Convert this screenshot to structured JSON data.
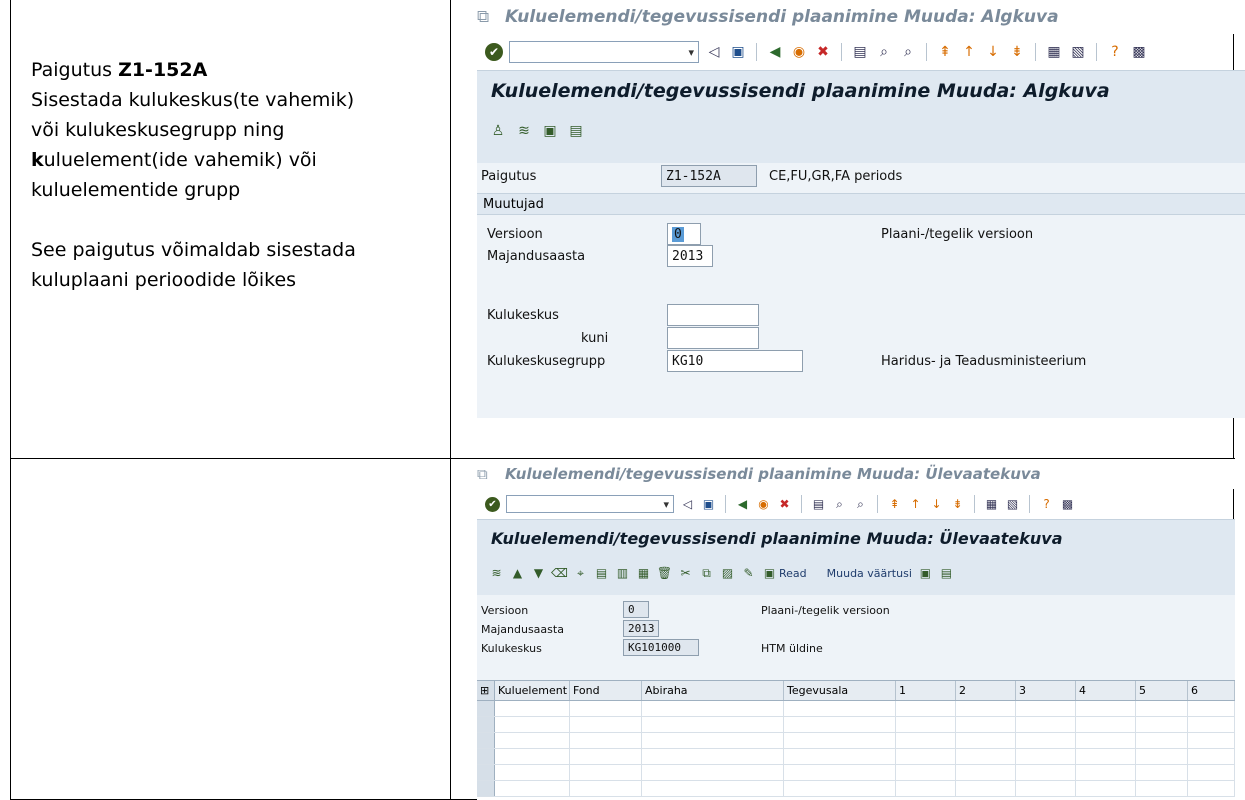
{
  "left": {
    "line1_prefix": "Paigutus ",
    "line1_code": "Z1-152A",
    "line2": "Sisestada kulukeskus(te vahemik)",
    "line3": "või kulukeskusegrupp ning",
    "line4_bold": "k",
    "line4_rest": "uluelement(ide vahemik) või",
    "line5": "kuluelementide grupp",
    "line6": "See paigutus võimaldab sisestada",
    "line7": "kuluplaani perioodide lõikes"
  },
  "pane1": {
    "window_title": "Kuluelemendi/tegevussisendi plaanimine Muuda: Algkuva",
    "screen_title": "Kuluelemendi/tegevussisendi plaanimine Muuda: Algkuva",
    "layout_label": "Paigutus",
    "layout_value": "Z1-152A",
    "layout_desc": "CE,FU,GR,FA periods",
    "group_title": "Muutujad",
    "version_label": "Versioon",
    "version_value": "0",
    "version_desc": "Plaani-/tegelik versioon",
    "year_label": "Majandusaasta",
    "year_value": "2013",
    "cc_label": "Kulukeskus",
    "cc_value": "",
    "to_label": "kuni",
    "to_value": "",
    "ccg_label": "Kulukeskusegrupp",
    "ccg_value": "KG10",
    "ccg_desc": "Haridus- ja Teadusministeerium"
  },
  "pane2": {
    "window_title": "Kuluelemendi/tegevussisendi plaanimine Muuda: Ülevaatekuva",
    "screen_title": "Kuluelemendi/tegevussisendi plaanimine Muuda: Ülevaatekuva",
    "read_label": "Read",
    "change_values_label": "Muuda väärtusi",
    "version_label": "Versioon",
    "version_value": "0",
    "version_desc": "Plaani-/tegelik versioon",
    "year_label": "Majandusaasta",
    "year_value": "2013",
    "cc_label": "Kulukeskus",
    "cc_value": "KG101000",
    "cc_desc": "HTM üldine",
    "columns": [
      "Kuluelement",
      "Fond",
      "Abiraha",
      "Tegevusala",
      "1",
      "2",
      "3",
      "4",
      "5",
      "6"
    ]
  }
}
